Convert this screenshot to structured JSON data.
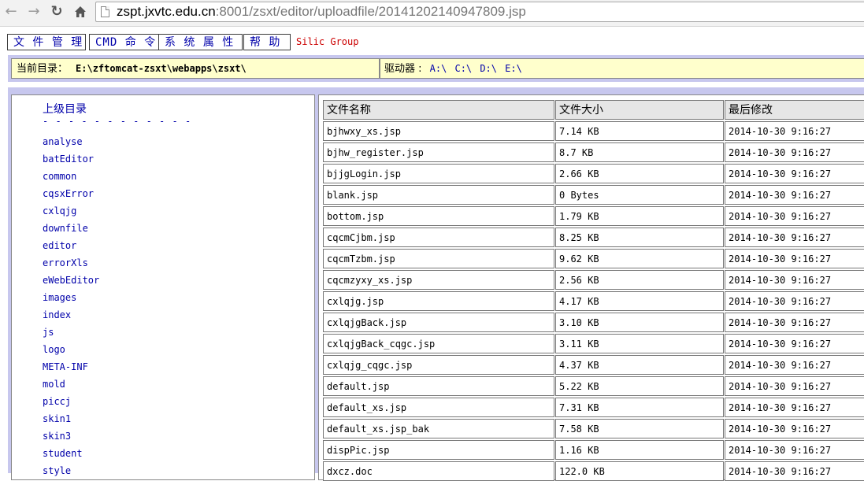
{
  "browser": {
    "url_host": "zspt.jxvtc.edu.cn",
    "url_rest": ":8001/zsxt/editor/uploadfile/20141202140947809.jsp"
  },
  "menu": {
    "file_manage": "文 件 管 理",
    "cmd": "CMD 命 令",
    "sys_props": "系 统 属 性",
    "help": "帮 助",
    "brand": "Silic Group"
  },
  "path": {
    "label": "当前目录：",
    "value": "E:\\zftomcat-zsxt\\webapps\\zsxt\\",
    "drives_label": "驱动器 :",
    "drives": [
      "A:\\",
      "C:\\",
      "D:\\",
      "E:\\"
    ]
  },
  "tree": {
    "up_label": "上级目录",
    "separator": "- - - - - - - - - - - -",
    "folders": [
      "analyse",
      "batEditor",
      "common",
      "cqsxError",
      "cxlqjg",
      "downfile",
      "editor",
      "errorXls",
      "eWebEditor",
      "images",
      "index",
      "js",
      "logo",
      "META-INF",
      "mold",
      "piccj",
      "skin1",
      "skin3",
      "student",
      "style"
    ]
  },
  "files": {
    "headers": [
      "文件名称",
      "文件大小",
      "最后修改"
    ],
    "rows": [
      [
        "bjhwxy_xs.jsp",
        "7.14 KB",
        "2014-10-30 9:16:27"
      ],
      [
        "bjhw_register.jsp",
        "8.7 KB",
        "2014-10-30 9:16:27"
      ],
      [
        "bjjgLogin.jsp",
        "2.66 KB",
        "2014-10-30 9:16:27"
      ],
      [
        "blank.jsp",
        "0 Bytes",
        "2014-10-30 9:16:27"
      ],
      [
        "bottom.jsp",
        "1.79 KB",
        "2014-10-30 9:16:27"
      ],
      [
        "cqcmCjbm.jsp",
        "8.25 KB",
        "2014-10-30 9:16:27"
      ],
      [
        "cqcmTzbm.jsp",
        "9.62 KB",
        "2014-10-30 9:16:27"
      ],
      [
        "cqcmzyxy_xs.jsp",
        "2.56 KB",
        "2014-10-30 9:16:27"
      ],
      [
        "cxlqjg.jsp",
        "4.17 KB",
        "2014-10-30 9:16:27"
      ],
      [
        "cxlqjgBack.jsp",
        "3.10 KB",
        "2014-10-30 9:16:27"
      ],
      [
        "cxlqjgBack_cqgc.jsp",
        "3.11 KB",
        "2014-10-30 9:16:27"
      ],
      [
        "cxlqjg_cqgc.jsp",
        "4.37 KB",
        "2014-10-30 9:16:27"
      ],
      [
        "default.jsp",
        "5.22 KB",
        "2014-10-30 9:16:27"
      ],
      [
        "default_xs.jsp",
        "7.31 KB",
        "2014-10-30 9:16:27"
      ],
      [
        "default_xs.jsp_bak",
        "7.58 KB",
        "2014-10-30 9:16:27"
      ],
      [
        "dispPic.jsp",
        "1.16 KB",
        "2014-10-30 9:16:27"
      ],
      [
        "dxcz.doc",
        "122.0 KB",
        "2014-10-30 9:16:27"
      ]
    ]
  }
}
